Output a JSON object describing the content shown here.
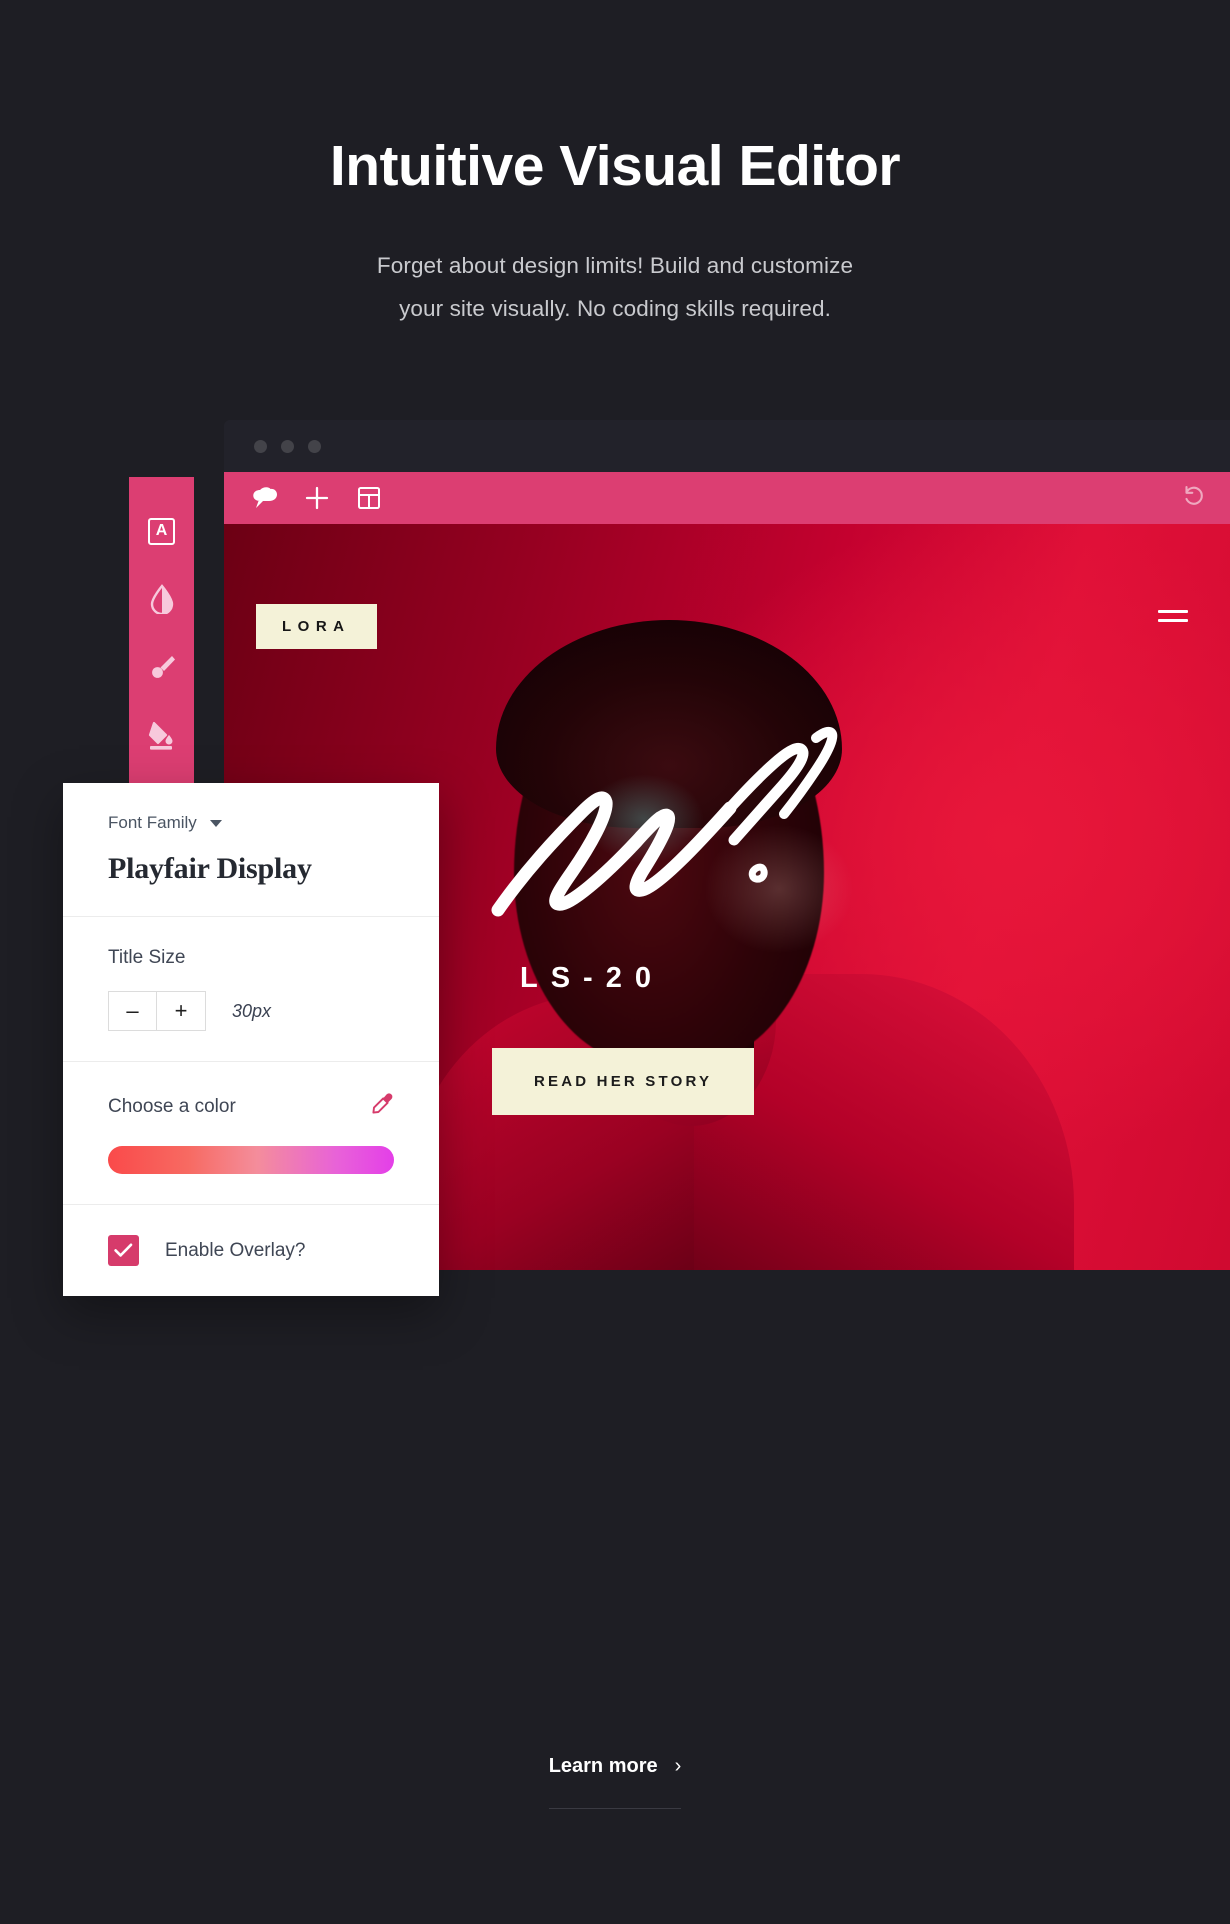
{
  "header": {
    "title": "Intuitive Visual Editor",
    "subtitle_line1": "Forget about design limits! Build and customize",
    "subtitle_line2": "your site visually. No coding skills required."
  },
  "browser": {
    "window_dots": 3,
    "toolbar": {
      "logo_icon": "cloud-logo-icon",
      "add_icon": "plus-icon",
      "layout_icon": "layout-grid-icon",
      "undo_icon": "undo-arrow-icon",
      "background_color": "#dc3e72"
    }
  },
  "tool_rail": {
    "background_color": "#dc3e72",
    "items": [
      {
        "icon": "text-box-icon",
        "glyph": "A"
      },
      {
        "icon": "opacity-droplet-icon"
      },
      {
        "icon": "paint-brush-icon"
      },
      {
        "icon": "paint-bucket-icon"
      }
    ]
  },
  "hero": {
    "badge": "LORA",
    "menu_icon": "hamburger-menu-icon",
    "script_overlay": "handwritten-script-overlay",
    "subtitle": "LS-20",
    "cta_label": "READ HER STORY",
    "badge_background": "#f4f2d8",
    "canvas_color": "#c4012f"
  },
  "panel": {
    "font_family": {
      "label": "Font Family",
      "value": "Playfair Display",
      "caret_icon": "chevron-down-icon"
    },
    "title_size": {
      "label": "Title Size",
      "decrease_label": "–",
      "increase_label": "+",
      "value": "30px"
    },
    "color": {
      "label": "Choose a color",
      "eyedropper_icon": "eyedropper-icon",
      "gradient_start": "#fa4a4a",
      "gradient_end": "#e43fe8"
    },
    "overlay": {
      "label": "Enable Overlay?",
      "checked": true,
      "checkbox_color": "#d63b6b",
      "check_icon": "checkmark-icon"
    }
  },
  "footer": {
    "learn_more_label": "Learn more",
    "chevron_icon": "chevron-right-icon",
    "chevron_glyph": "›"
  }
}
